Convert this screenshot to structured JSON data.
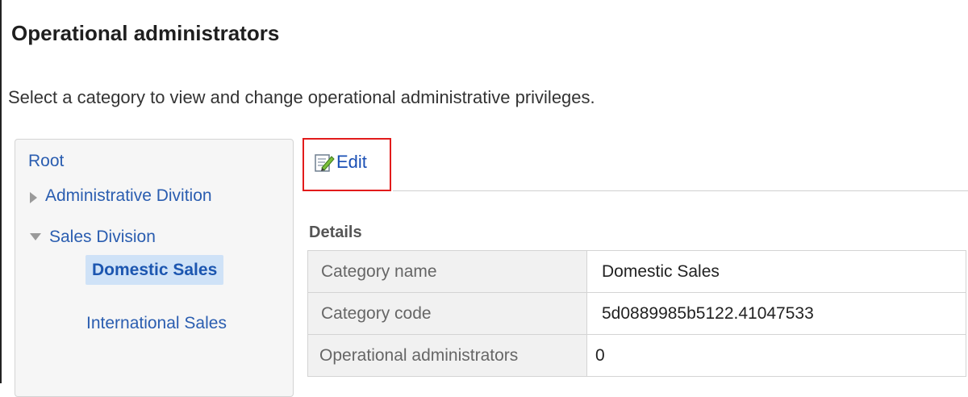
{
  "page": {
    "title": "Operational administrators",
    "description": "Select a category to view and change operational administrative privileges."
  },
  "tree": {
    "root": "Root",
    "items": [
      {
        "label": "Administrative Divition",
        "state": "collapsed"
      },
      {
        "label": "Sales Division",
        "state": "expanded"
      }
    ],
    "children": [
      {
        "label": "Domestic Sales",
        "selected": true
      },
      {
        "label": "International Sales",
        "selected": false
      }
    ]
  },
  "toolbar": {
    "edit_label": "Edit",
    "edit_icon": "edit-icon"
  },
  "details": {
    "section_label": "Details",
    "rows": [
      {
        "label": "Category name",
        "value": "Domestic Sales"
      },
      {
        "label": "Category code",
        "value": "5d0889985b5122.41047533"
      },
      {
        "label": "Operational administrators",
        "value": "0"
      }
    ]
  },
  "colors": {
    "link": "#2a5db0",
    "highlight": "#e21b1b",
    "selected_bg": "#cfe2f7",
    "header_bg": "#f1f1f1"
  }
}
